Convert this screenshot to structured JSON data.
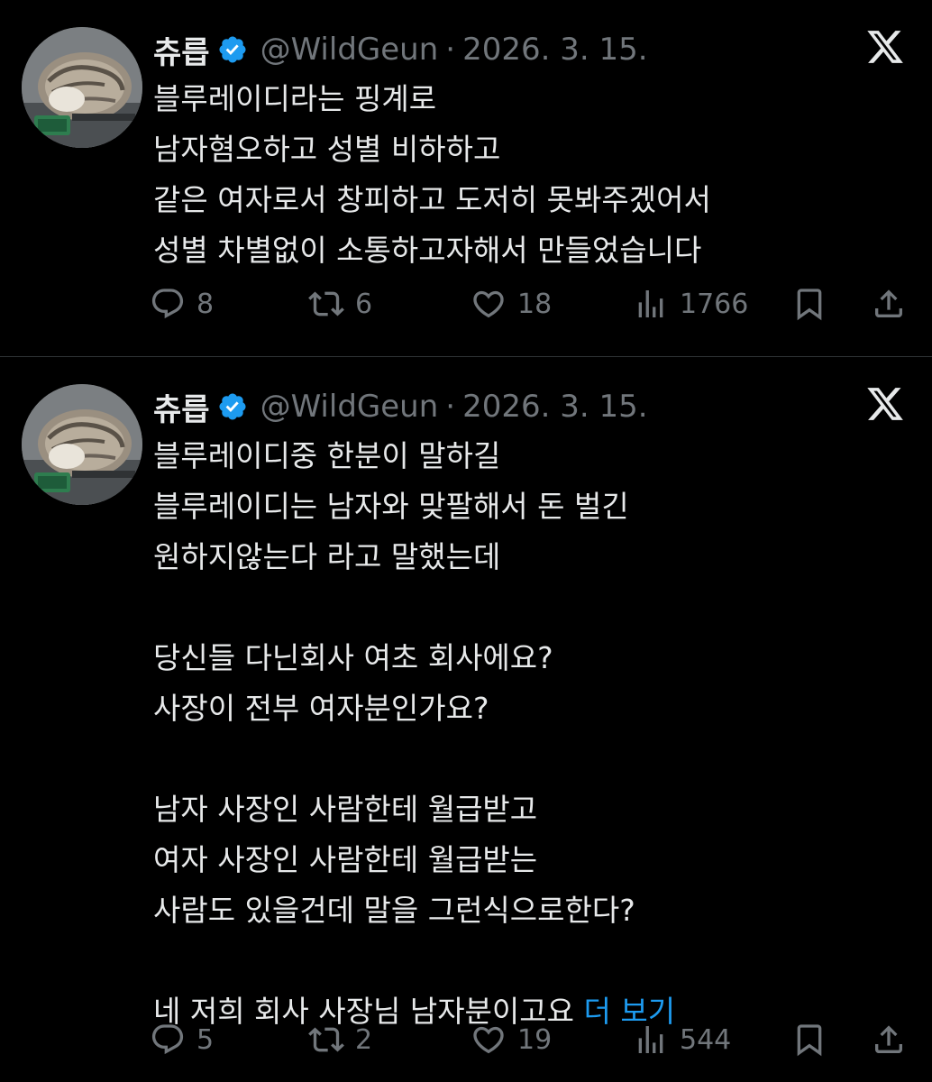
{
  "tweets": [
    {
      "author": {
        "display_name": "츄릅",
        "handle": "@WildGeun",
        "verified": true,
        "avatar": "cat-avatar"
      },
      "separator": "·",
      "date": "2026. 3. 15.",
      "text_lines": [
        "블루레이디라는 핑계로",
        "남자혐오하고 성별 비하하고",
        "같은 여자로서 창피하고 도저히 못봐주겠어서",
        "성별 차별없이 소통하고자해서 만들었습니다"
      ],
      "stats": {
        "replies": "8",
        "retweets": "6",
        "likes": "18",
        "views": "1766"
      }
    },
    {
      "author": {
        "display_name": "츄릅",
        "handle": "@WildGeun",
        "verified": true,
        "avatar": "cat-avatar"
      },
      "separator": "·",
      "date": "2026. 3. 15.",
      "text_lines": [
        "블루레이디중 한분이 말하길",
        "블루레이디는 남자와 맞팔해서 돈 벌긴",
        "원하지않는다 라고 말했는데",
        "",
        "당신들 다닌회사 여초 회사에요?",
        "사장이 전부 여자분인가요?",
        "",
        "남자 사장인 사람한테 월급받고",
        "여자 사장인 사람한테 월급받는",
        "사람도 있을건데 말을 그런식으로한다?",
        "",
        "네 저희 회사 사장님 남자분이고요"
      ],
      "more_link": "더 보기",
      "stats": {
        "replies": "5",
        "retweets": "2",
        "likes": "19",
        "views": "544"
      }
    }
  ],
  "colors": {
    "background": "#000000",
    "text_primary": "#e7e9ea",
    "text_secondary": "#71767b",
    "link": "#1d9bf0",
    "verified_badge": "#1d9bf0",
    "divider": "#2f3336"
  },
  "icons": {
    "platform": "x-logo-icon",
    "reply": "reply-icon",
    "retweet": "retweet-icon",
    "like": "heart-icon",
    "views": "views-icon",
    "bookmark": "bookmark-icon",
    "share": "share-icon"
  }
}
